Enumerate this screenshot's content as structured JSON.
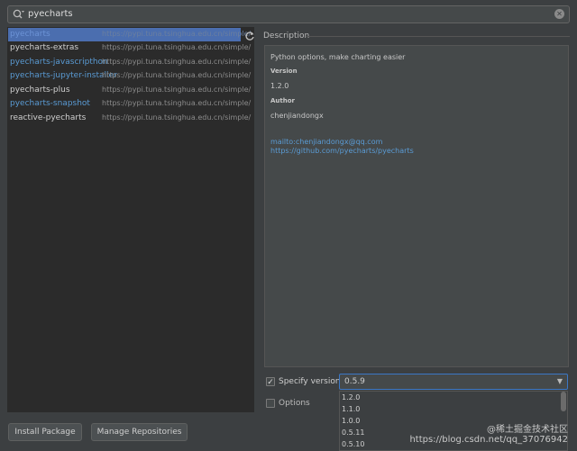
{
  "search": {
    "value": "pyecharts"
  },
  "packages": [
    {
      "name": "pyecharts",
      "url": "https://pypi.tuna.tsinghua.edu.cn/simple/",
      "selected": true
    },
    {
      "name": "pyecharts-extras",
      "url": "https://pypi.tuna.tsinghua.edu.cn/simple/"
    },
    {
      "name": "pyecharts-javascripthon",
      "url": "https://pypi.tuna.tsinghua.edu.cn/simple/"
    },
    {
      "name": "pyecharts-jupyter-installer",
      "url": "https://pypi.tuna.tsinghua.edu.cn/simple/"
    },
    {
      "name": "pyecharts-plus",
      "url": "https://pypi.tuna.tsinghua.edu.cn/simple/"
    },
    {
      "name": "pyecharts-snapshot",
      "url": "https://pypi.tuna.tsinghua.edu.cn/simple/"
    },
    {
      "name": "reactive-pyecharts",
      "url": "https://pypi.tuna.tsinghua.edu.cn/simple/"
    }
  ],
  "description": {
    "label": "Description",
    "summary": "Python options, make charting easier",
    "version_heading": "Version",
    "version": "1.2.0",
    "author_heading": "Author",
    "author": "chenjiandongx",
    "email_link": "mailto:chenjiandongx@qq.com",
    "repo_link": "https://github.com/pyecharts/pyecharts"
  },
  "specify_version": {
    "label": "Specify version",
    "checked": true,
    "value": "0.5.9"
  },
  "options": {
    "label": "Options",
    "checked": false
  },
  "version_options": [
    "1.2.0",
    "1.1.0",
    "1.0.0",
    "0.5.11",
    "0.5.10"
  ],
  "buttons": {
    "install": "Install Package",
    "manage": "Manage Repositories"
  },
  "watermark": {
    "line1": "@稀土掘金技术社区",
    "line2": "https://blog.csdn.net/qq_37076942"
  }
}
